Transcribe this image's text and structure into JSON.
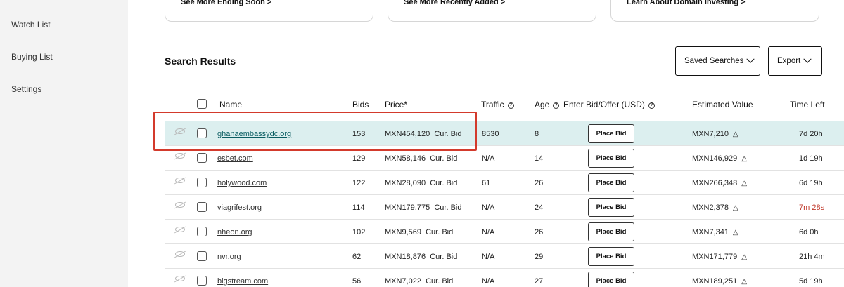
{
  "sidebar": {
    "items": [
      {
        "label": "Watch List"
      },
      {
        "label": "Buying List"
      },
      {
        "label": "Settings"
      }
    ]
  },
  "cards": [
    {
      "label": "See More Ending Soon",
      "arrow": ">"
    },
    {
      "label": "See More Recently Added",
      "arrow": ">"
    },
    {
      "label": "Learn About Domain Investing",
      "arrow": ">"
    }
  ],
  "search_results": {
    "title": "Search Results",
    "saved_searches_label": "Saved Searches",
    "export_label": "Export"
  },
  "table": {
    "headers": {
      "name": "Name",
      "bids": "Bids",
      "price": "Price*",
      "traffic": "Traffic",
      "age": "Age",
      "enter_bid": "Enter Bid/Offer (USD)",
      "estimated_value": "Estimated Value",
      "time_left": "Time Left"
    },
    "place_bid_label": "Place Bid",
    "rows": [
      {
        "name": "ghanaembassydc.org",
        "bids": "153",
        "price": "MXN454,120",
        "price_type": "Cur. Bid",
        "traffic": "8530",
        "age": "8",
        "est_value": "MXN7,210",
        "time_left": "7d 20h"
      },
      {
        "name": "esbet.com",
        "bids": "129",
        "price": "MXN58,146",
        "price_type": "Cur. Bid",
        "traffic": "N/A",
        "age": "14",
        "est_value": "MXN146,929",
        "time_left": "1d 19h"
      },
      {
        "name": "holywood.com",
        "bids": "122",
        "price": "MXN28,090",
        "price_type": "Cur. Bid",
        "traffic": "61",
        "age": "26",
        "est_value": "MXN266,348",
        "time_left": "6d 19h"
      },
      {
        "name": "viagrifest.org",
        "bids": "114",
        "price": "MXN179,775",
        "price_type": "Cur. Bid",
        "traffic": "N/A",
        "age": "24",
        "est_value": "MXN2,378",
        "time_left": "7m 28s"
      },
      {
        "name": "nheon.org",
        "bids": "102",
        "price": "MXN9,569",
        "price_type": "Cur. Bid",
        "traffic": "N/A",
        "age": "26",
        "est_value": "MXN7,341",
        "time_left": "6d 0h"
      },
      {
        "name": "nvr.org",
        "bids": "62",
        "price": "MXN18,876",
        "price_type": "Cur. Bid",
        "traffic": "N/A",
        "age": "29",
        "est_value": "MXN171,779",
        "time_left": "21h 4m"
      },
      {
        "name": "bigstream.com",
        "bids": "56",
        "price": "MXN7,022",
        "price_type": "Cur. Bid",
        "traffic": "N/A",
        "age": "27",
        "est_value": "MXN189,251",
        "time_left": "5d 19h"
      }
    ]
  },
  "colors": {
    "sidebar_bg": "#f3f3f3",
    "highlight_row": "#dcefef",
    "annotation_border": "#d33a2c",
    "urgent_time": "#c0392b"
  }
}
